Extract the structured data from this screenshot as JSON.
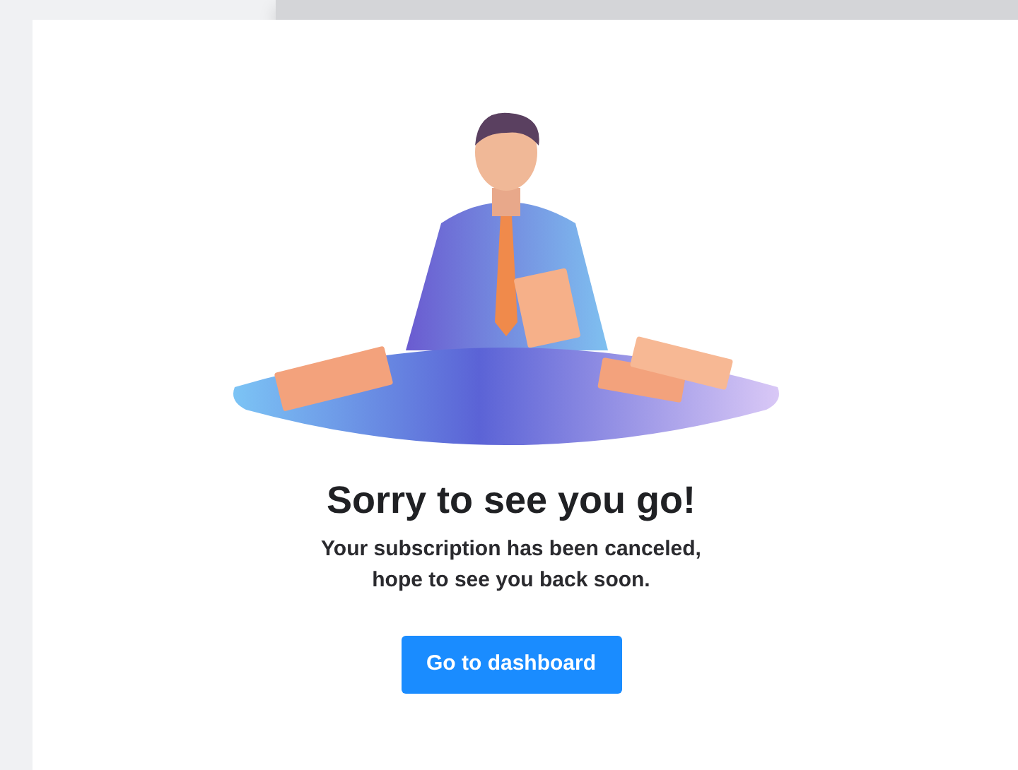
{
  "card": {
    "title": "Sorry to see you go!",
    "message_lines": [
      "Your subscription has been canceled,",
      "hope to see you back soon."
    ],
    "button": {
      "label": "Go to dashboard"
    }
  }
}
